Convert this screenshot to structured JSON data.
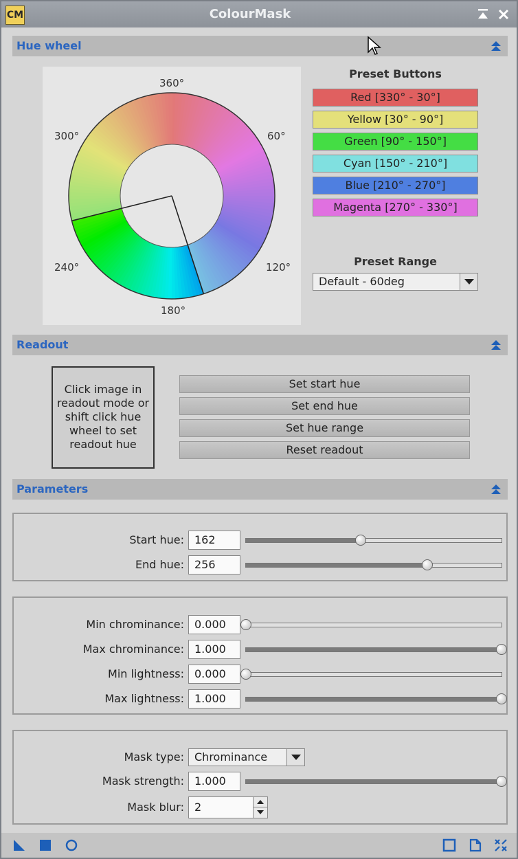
{
  "window": {
    "title": "ColourMask",
    "icon_text": "CM"
  },
  "sections": {
    "hue_wheel": "Hue wheel",
    "readout": "Readout",
    "parameters": "Parameters"
  },
  "hue_wheel": {
    "degree_labels": [
      "360°",
      "60°",
      "120°",
      "180°",
      "240°",
      "300°"
    ]
  },
  "presets": {
    "heading": "Preset Buttons",
    "buttons": [
      {
        "label": "Red [330° - 30°]",
        "color": "#e06060"
      },
      {
        "label": "Yellow [30° - 90°]",
        "color": "#e4e07a"
      },
      {
        "label": "Green [90° - 150°]",
        "color": "#44dd44"
      },
      {
        "label": "Cyan [150° - 210°]",
        "color": "#80e0e0"
      },
      {
        "label": "Blue [210° - 270°]",
        "color": "#4f7fe0"
      },
      {
        "label": "Magenta [270° - 330°]",
        "color": "#e070e0"
      }
    ],
    "range_heading": "Preset Range",
    "range_value": "Default - 60deg"
  },
  "readout": {
    "instructions": "Click image in readout mode or shift click hue wheel to set readout hue",
    "buttons": [
      "Set start hue",
      "Set end hue",
      "Set hue range",
      "Reset readout"
    ]
  },
  "parameters": {
    "hue": [
      {
        "label": "Start hue:",
        "value": "162",
        "fraction": 0.45
      },
      {
        "label": "End hue:",
        "value": "256",
        "fraction": 0.71
      }
    ],
    "chroma": [
      {
        "label": "Min chrominance:",
        "value": "0.000",
        "fraction": 0.0
      },
      {
        "label": "Max chrominance:",
        "value": "1.000",
        "fraction": 1.0
      },
      {
        "label": "Min lightness:",
        "value": "0.000",
        "fraction": 0.0
      },
      {
        "label": "Max lightness:",
        "value": "1.000",
        "fraction": 1.0
      }
    ],
    "mask_type_label": "Mask type:",
    "mask_type_value": "Chrominance",
    "mask_strength_label": "Mask strength:",
    "mask_strength_value": "1.000",
    "mask_strength_fraction": 1.0,
    "mask_blur_label": "Mask blur:",
    "mask_blur_value": "2"
  },
  "colors": {
    "section_title": "#2c66c0",
    "accent": "#1d5fb8"
  }
}
